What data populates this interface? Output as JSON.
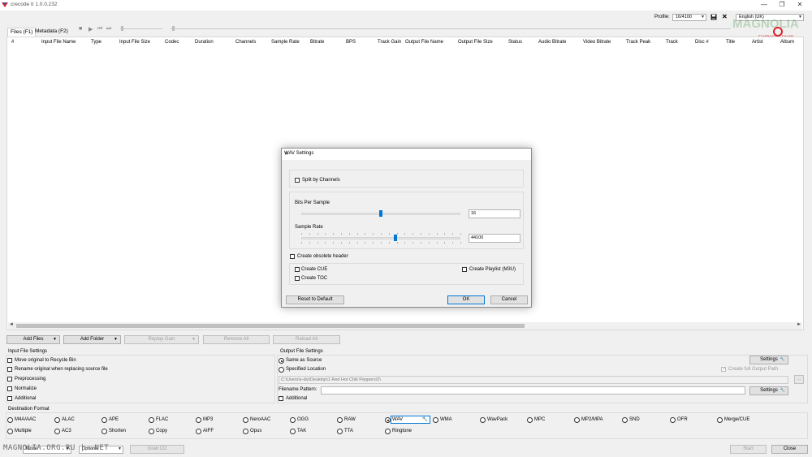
{
  "window": {
    "title": "crecode II 1.0.0.232",
    "controls": {
      "minimize": "—",
      "maximize": "❐",
      "close": "✕"
    }
  },
  "toolbar": {
    "profile_label": "Profile:",
    "profile_value": "16/4100",
    "language_value": "English (UK)"
  },
  "watermark": {
    "lines": [
      "MAGNOLIA",
      "Cerberus Team"
    ]
  },
  "tabs": [
    {
      "label": "Files (F1)",
      "active": true
    },
    {
      "label": "Metadata (F2)",
      "active": false
    }
  ],
  "grid": {
    "columns": [
      "#",
      "Input File Name",
      "Type",
      "Input File Size",
      "Codec",
      "Duration",
      "Channels",
      "Sample Rate",
      "Bitrate",
      "BPS",
      "Track Gain",
      "Output File Name",
      "Output File Size",
      "Status",
      "Audio Bitrate",
      "Video Bitrate",
      "Track Peak",
      "Track",
      "Disc #",
      "Title",
      "Artist",
      "Album"
    ],
    "scroll_left": "◄",
    "scroll_right": "►"
  },
  "file_buttons": {
    "add_files": "Add Files",
    "add_folder": "Add Folder",
    "replay_gain": "Replay Gain",
    "remove_all": "Remove All",
    "reload_all": "Reload All"
  },
  "input_settings": {
    "title": "Input File Settings",
    "options": [
      "Move original to Recycle Bin",
      "Rename original when replacing source file",
      "Preprocessing",
      "Normalize",
      "Additional"
    ]
  },
  "output_settings": {
    "title": "Output File Settings",
    "same_as_source": "Same as Source",
    "specified_location": "Specified Location",
    "settings_button": "Settings",
    "create_full_output_path": "Create full Output Path",
    "path_value": "C:\\Users\\x-diz\\Desktop\\1 Red Hot Chili Peppers\\2\\",
    "browse_button": "...",
    "filename_pattern_label": "Filename Pattern:",
    "filename_pattern_value": "",
    "settings_button_2": "Settings",
    "additional": "Additional"
  },
  "destination": {
    "title": "Destination Format",
    "row1": [
      "M4A/AAC",
      "ALAC",
      "APE",
      "FLAC",
      "MP3",
      "NeroAAC",
      "OGG",
      "RAW",
      "WAV",
      "WMA",
      "WavPack",
      "MPC",
      "MP2/MPA",
      "SND",
      "OFR",
      "Merge/CUE"
    ],
    "row2": [
      "Multiple",
      "AC3",
      "Shorten",
      "Copy",
      "AIFF",
      "Opus",
      "TAK",
      "TTA",
      "Ringtone"
    ],
    "selected": "WAV"
  },
  "bottom": {
    "mode_value": "Mode",
    "options_value": "Options",
    "grab_cd": "Grab CD",
    "start": "Start",
    "close": "Close",
    "watermark_text": "MAGNOLIA.ORG.RU | .NET"
  },
  "dialog": {
    "title": "WAV Settings",
    "close": "✕",
    "split_by_channels": "Split by Channels",
    "bits_per_sample_label": "Bits Per Sample",
    "bits_per_sample_value": "16",
    "bits_level": 0.5,
    "sample_rate_label": "Sample Rate",
    "sample_rate_value": "44100",
    "rate_level": 0.59,
    "create_obsolete_header": "Create obsolete header",
    "create_cue": "Create CUE",
    "create_toc": "Create TOC",
    "create_playlist": "Create Playlist (M3U)",
    "reset_button": "Reset to Default",
    "ok_button": "OK",
    "cancel_button": "Cancel"
  },
  "colors": {
    "accent": "#0078d7",
    "logo_red": "#d9232d",
    "logo_blue": "#1e5aa8",
    "watermark_green": "#5aa05a"
  }
}
